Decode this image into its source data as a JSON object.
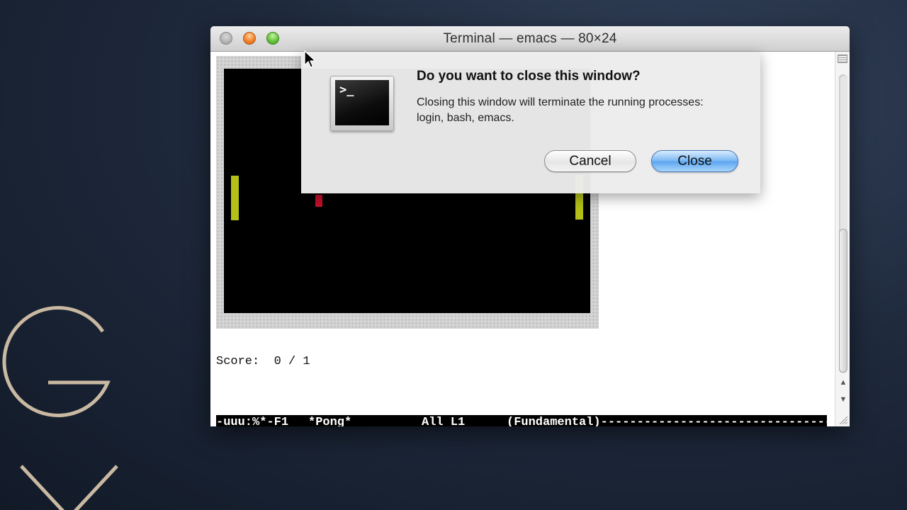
{
  "window": {
    "title": "Terminal — emacs — 80×24"
  },
  "terminal": {
    "score_line": "Score:  0 / 1",
    "modeline": {
      "status": "-uuu:%*-F1",
      "buffer": "*Pong*",
      "position": "All L1",
      "mode": "(Fundamental)----------------------------------"
    }
  },
  "dialog": {
    "title": "Do you want to close this window?",
    "message": "Closing this window will terminate the running processes: login, bash, emacs.",
    "icon_text": ">_",
    "cancel_label": "Cancel",
    "close_label": "Close"
  },
  "colors": {
    "paddle": "#b4bf18",
    "ball": "#c4102a",
    "default_button": "#5aa4f0"
  }
}
